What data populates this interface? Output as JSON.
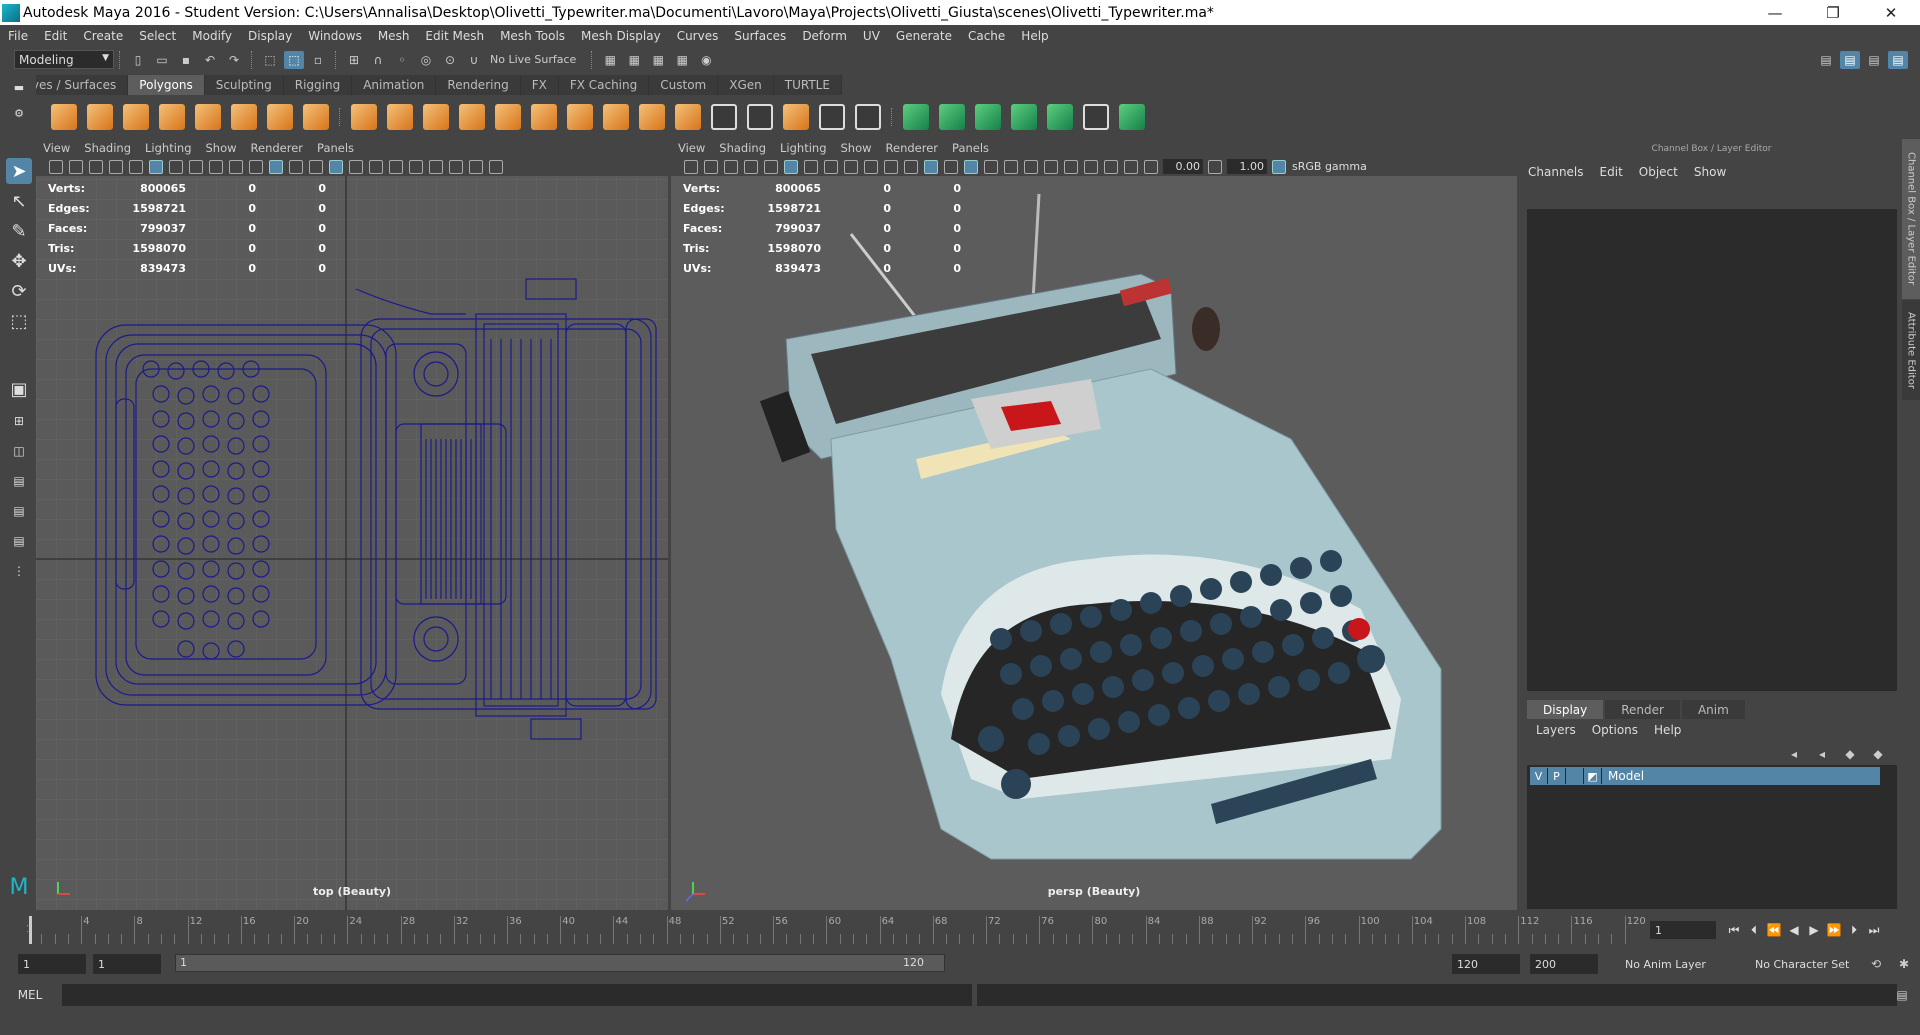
{
  "window": {
    "title": "Autodesk Maya 2016 - Student Version: C:\\Users\\Annalisa\\Desktop\\Olivetti_Typewriter.ma\\Documenti\\Lavoro\\Maya\\Projects\\Olivetti_Giusta\\scenes\\Olivetti_Typewriter.ma*"
  },
  "menu": [
    "File",
    "Edit",
    "Create",
    "Select",
    "Modify",
    "Display",
    "Windows",
    "Mesh",
    "Edit Mesh",
    "Mesh Tools",
    "Mesh Display",
    "Curves",
    "Surfaces",
    "Deform",
    "UV",
    "Generate",
    "Cache",
    "Help"
  ],
  "status": {
    "mode": "Modeling",
    "live_surface": "No Live Surface"
  },
  "shelf_tabs": [
    "Curves / Surfaces",
    "Polygons",
    "Sculpting",
    "Rigging",
    "Animation",
    "Rendering",
    "FX",
    "FX Caching",
    "Custom",
    "XGen",
    "TURTLE"
  ],
  "shelf_active": "Polygons",
  "viewport_menu": [
    "View",
    "Shading",
    "Lighting",
    "Show",
    "Renderer",
    "Panels"
  ],
  "hud": [
    {
      "k": "Verts:",
      "v": "800065",
      "a": "0",
      "b": "0"
    },
    {
      "k": "Edges:",
      "v": "1598721",
      "a": "0",
      "b": "0"
    },
    {
      "k": "Faces:",
      "v": "799037",
      "a": "0",
      "b": "0"
    },
    {
      "k": "Tris:",
      "v": "1598070",
      "a": "0",
      "b": "0"
    },
    {
      "k": "UVs:",
      "v": "839473",
      "a": "0",
      "b": "0"
    }
  ],
  "viewport_left": {
    "label": "top (Beauty)"
  },
  "viewport_right": {
    "label": "persp (Beauty)",
    "exposure": "0.00",
    "gamma": "1.00",
    "colorspace": "sRGB gamma"
  },
  "channel_box": {
    "title": "Channel Box / Layer Editor",
    "menu": [
      "Channels",
      "Edit",
      "Object",
      "Show"
    ],
    "layer_tabs": [
      "Display",
      "Render",
      "Anim"
    ],
    "layer_menu": [
      "Layers",
      "Options",
      "Help"
    ],
    "layer": {
      "v": "V",
      "p": "P",
      "name": "Model"
    }
  },
  "side_tabs": {
    "channel": "Channel Box / Layer Editor",
    "attribute": "Attribute Editor"
  },
  "timeline": {
    "ticks": [
      "4",
      "8",
      "12",
      "16",
      "20",
      "24",
      "28",
      "32",
      "36",
      "40",
      "44",
      "48",
      "52",
      "56",
      "60",
      "64",
      "68",
      "72",
      "76",
      "80",
      "84",
      "88",
      "92",
      "96",
      "100",
      "104",
      "108",
      "112",
      "116",
      "120"
    ],
    "start_mark": "1",
    "current": "1"
  },
  "range": {
    "start": "1",
    "start2": "1",
    "slider_start": "1",
    "slider_end": "120",
    "end": "120",
    "end2": "200",
    "anim_layer": "No Anim Layer",
    "char_set": "No Character Set"
  },
  "cmdline": {
    "lang": "MEL"
  },
  "colors": {
    "accent": "#5285a6",
    "panel": "#444444",
    "viewport": "#5a5a5a",
    "wire": "#1a1a8c",
    "body": "#a8c6cc"
  }
}
